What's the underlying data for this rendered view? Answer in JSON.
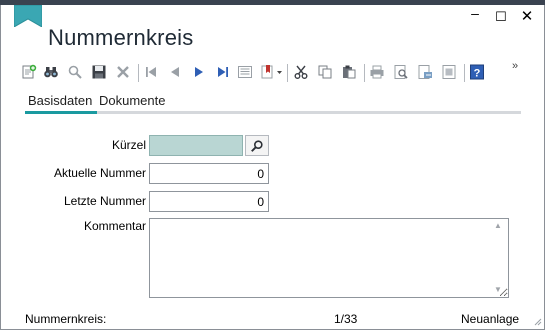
{
  "window": {
    "title": "Nummernkreis",
    "controls": {
      "minimize": "–",
      "maximize": "☐",
      "close": "✕"
    },
    "accent_color": "#1a9aa0"
  },
  "toolbar": {
    "icons": [
      "new-icon",
      "binoculars-icon",
      "search-icon",
      "save-icon",
      "delete-icon",
      "first-record-icon",
      "previous-record-icon",
      "next-record-icon",
      "last-record-icon",
      "list-icon",
      "bookmark-dropdown-icon",
      "cut-icon",
      "copy-icon",
      "paste-icon",
      "print-icon",
      "print-preview-icon",
      "export-icon",
      "report-icon",
      "help-icon"
    ],
    "overflow": "»"
  },
  "tabs": [
    {
      "label": "Basisdaten",
      "active": true
    },
    {
      "label": "Dokumente",
      "active": false
    }
  ],
  "form": {
    "kuerzel_label": "Kürzel",
    "kuerzel_value": "",
    "aktuell_label": "Aktuelle Nummer",
    "aktuell_value": "0",
    "letzte_label": "Letzte Nummer",
    "letzte_value": "0",
    "kommentar_label": "Kommentar",
    "kommentar_value": ""
  },
  "status": {
    "left": "Nummernkreis:",
    "record": "1/33",
    "mode": "Neuanlage"
  }
}
